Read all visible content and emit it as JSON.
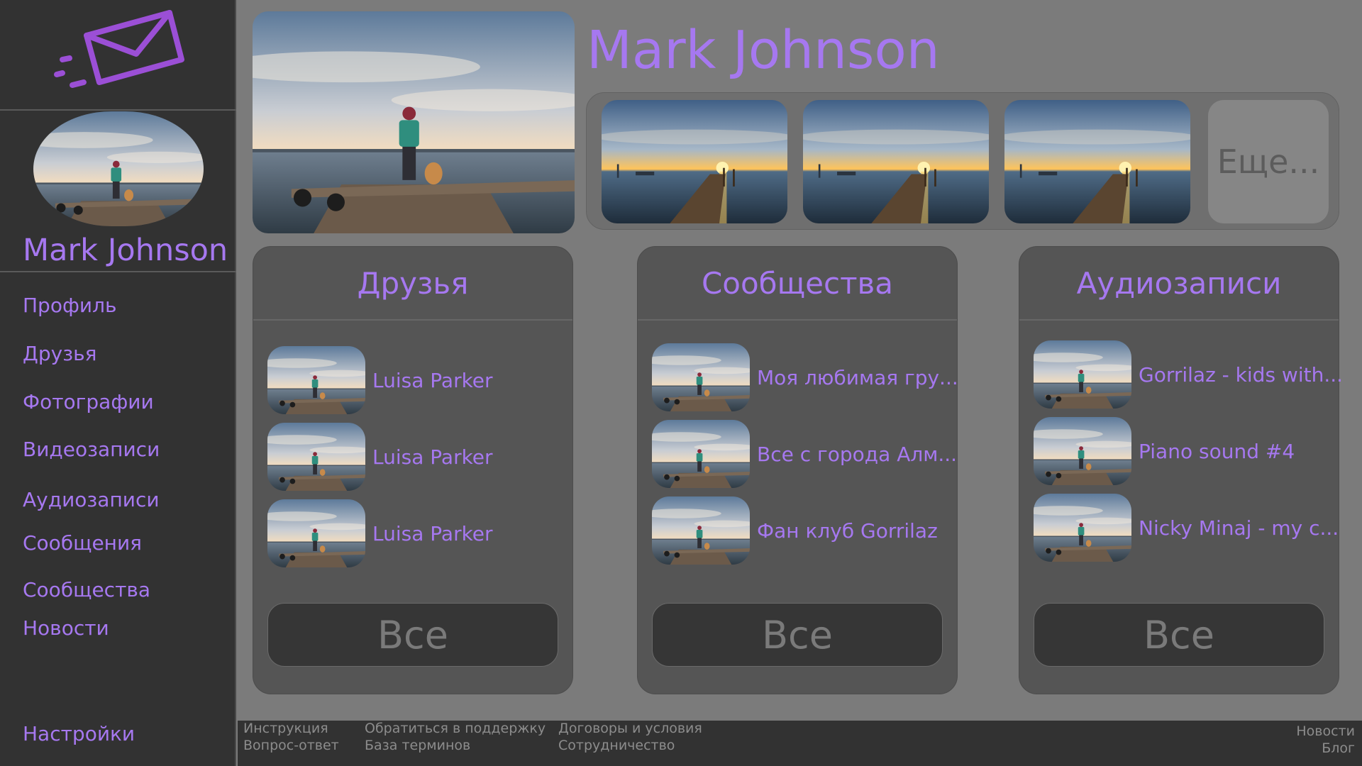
{
  "sidebar": {
    "user_name": "Mark Johnson",
    "nav": [
      "Профиль",
      "Друзья",
      "Фотографии",
      "Видеозаписи",
      "Аудиозаписи",
      "Сообщения",
      "Сообщества",
      "Новости"
    ],
    "settings": "Настройки"
  },
  "header": {
    "user_name": "Mark Johnson",
    "more_label": "Еще..."
  },
  "friends": {
    "title": "Друзья",
    "items": [
      "Luisa Parker",
      "Luisa Parker",
      "Luisa Parker"
    ],
    "all_label": "Все"
  },
  "communities": {
    "title": "Сообщества",
    "items": [
      "Моя любимая гру...",
      "Все с города Алм...",
      "Фан клуб Gorrilaz"
    ],
    "all_label": "Все"
  },
  "audio": {
    "title": "Аудиозаписи",
    "items": [
      "Gorrilaz - kids with...",
      "Piano sound #4",
      "Nicky Minaj - my c..."
    ],
    "all_label": "Все"
  },
  "footer": {
    "instructions": "Инструкция",
    "faq": "Вопрос-ответ",
    "support": "Обратиться в поддержку",
    "glossary": "База терминов",
    "terms": "Договоры и условия",
    "partnership": "Сотрудничество",
    "news": "Новости",
    "blog": "Блог"
  },
  "colors": {
    "accent": "#a678f0",
    "sidebar": "#323232",
    "page": "#7b7b7b",
    "panel": "#555555"
  },
  "icons": {
    "logo": "mail-envelope-icon"
  }
}
